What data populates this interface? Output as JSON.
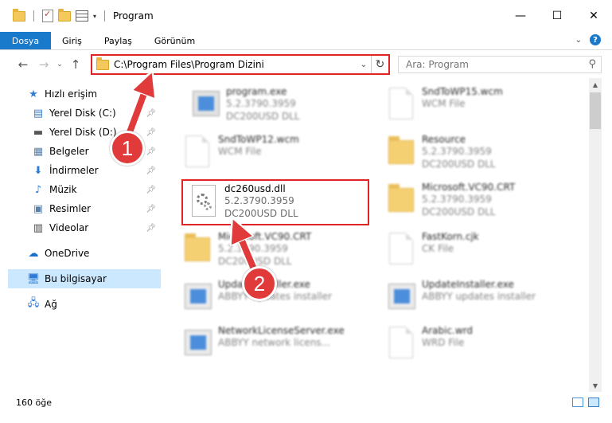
{
  "window": {
    "title": "Program",
    "controls": {
      "minimize": "—",
      "maximize": "☐",
      "close": "✕"
    }
  },
  "ribbon": {
    "file_tab": "Dosya",
    "tabs": [
      "Giriş",
      "Paylaş",
      "Görünüm"
    ],
    "help": "?"
  },
  "address": {
    "path": "C:\\Program Files\\Program Dizini",
    "search_placeholder": "Ara: Program"
  },
  "sidebar": {
    "quick_access": "Hızlı erişim",
    "items": [
      {
        "label": "Yerel Disk (C:)",
        "icon": "drive-icon"
      },
      {
        "label": "Yerel Disk (D:)",
        "icon": "drive-icon"
      },
      {
        "label": "Belgeler",
        "icon": "documents-icon"
      },
      {
        "label": "İndirmeler",
        "icon": "download-icon"
      },
      {
        "label": "Müzik",
        "icon": "music-icon"
      },
      {
        "label": "Resimler",
        "icon": "pictures-icon"
      },
      {
        "label": "Videolar",
        "icon": "videos-icon"
      }
    ],
    "onedrive": "OneDrive",
    "this_pc": "Bu bilgisayar",
    "network": "Ağ"
  },
  "files": [
    {
      "name": "program.exe",
      "line1": "5.2.3790.3959",
      "line2": "DC200USD DLL",
      "icon": "exe-icon"
    },
    {
      "name": "SndToWP15.wcm",
      "line1": "WCM File",
      "line2": "",
      "icon": "page-icon"
    },
    {
      "name": "SndToWP12.wcm",
      "line1": "WCM File",
      "line2": "",
      "icon": "page-icon"
    },
    {
      "name": "Resource",
      "line1": "5.2.3790.3959",
      "line2": "DC200USD DLL",
      "icon": "folder-icon"
    },
    {
      "name": "dc260usd.dll",
      "line1": "5.2.3790.3959",
      "line2": "DC200USD DLL",
      "icon": "dll-gear-icon"
    },
    {
      "name": "Microsoft.VC90.CRT",
      "line1": "5.2.3790.3959",
      "line2": "DC200USD DLL",
      "icon": "folder-icon"
    },
    {
      "name": "Microsoft.VC90.CRT",
      "line1": "5.2.3790.3959",
      "line2": "DC200USD DLL",
      "icon": "folder-icon"
    },
    {
      "name": "FastKorn.cjk",
      "line1": "CK File",
      "line2": "",
      "icon": "page-icon"
    },
    {
      "name": "UpdateInstaller.exe",
      "line1": "ABBYY updates installer",
      "line2": "",
      "icon": "installer-icon"
    },
    {
      "name": "UpdateInstaller.exe",
      "line1": "ABBYY updates installer",
      "line2": "",
      "icon": "installer-icon"
    },
    {
      "name": "NetworkLicenseServer.exe",
      "line1": "ABBYY network licens...",
      "line2": "",
      "icon": "installer-icon"
    },
    {
      "name": "Arabic.wrd",
      "line1": "WRD File",
      "line2": "",
      "icon": "page-icon"
    }
  ],
  "annotations": {
    "step1": "1",
    "step2": "2"
  },
  "status": {
    "count": "160 öğe"
  },
  "colors": {
    "accent": "#1979ca",
    "highlight": "#e02424",
    "selection": "#cce8ff"
  }
}
